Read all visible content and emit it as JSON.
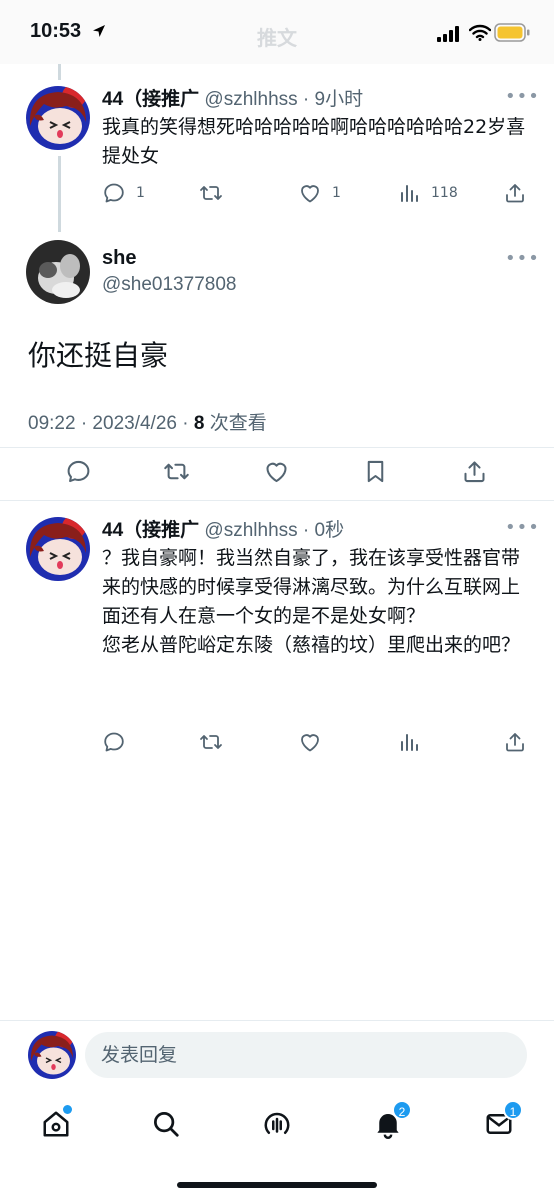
{
  "status_bar": {
    "time": "10:53"
  },
  "header": {
    "title": "推文"
  },
  "tweets": [
    {
      "name": "44（接推广",
      "handle": "@szhlhhss",
      "time": "· 9小时",
      "text": "我真的笑得想死哈哈哈哈哈啊哈哈哈哈哈哈22岁喜提处女",
      "replies": "1",
      "likes": "1",
      "views": "118"
    },
    {
      "name": "44（接推广",
      "handle": "@szhlhhss",
      "time": "· 0秒",
      "text": "？我自豪啊！我当然自豪了，我在该享受性器官带来的快感的时候享受得淋漓尽致。为什么互联网上面还有人在意一个女的是不是处女啊？\n您老从普陀峪定东陵（慈禧的坟）里爬出来的吧？"
    }
  ],
  "focus_tweet": {
    "name": "she",
    "handle": "@she01377808",
    "text": "你还挺自豪",
    "date": "09:22 · 2023/4/26 · ",
    "views_count": "8",
    "views_label": " 次查看"
  },
  "composer": {
    "placeholder": "发表回复"
  },
  "nav": {
    "notifications_badge": "2",
    "messages_badge": "1"
  },
  "colors": {
    "accent": "#1d9bf0",
    "secondary_text": "#536471",
    "primary_text": "#0f1419"
  },
  "icons": [
    "location-arrow-icon",
    "signal-icon",
    "wifi-icon",
    "battery-icon",
    "more-icon",
    "reply-icon",
    "retweet-icon",
    "like-icon",
    "views-icon",
    "share-icon",
    "bookmark-icon",
    "home-icon",
    "search-icon",
    "spaces-icon",
    "bell-icon",
    "mail-icon"
  ]
}
